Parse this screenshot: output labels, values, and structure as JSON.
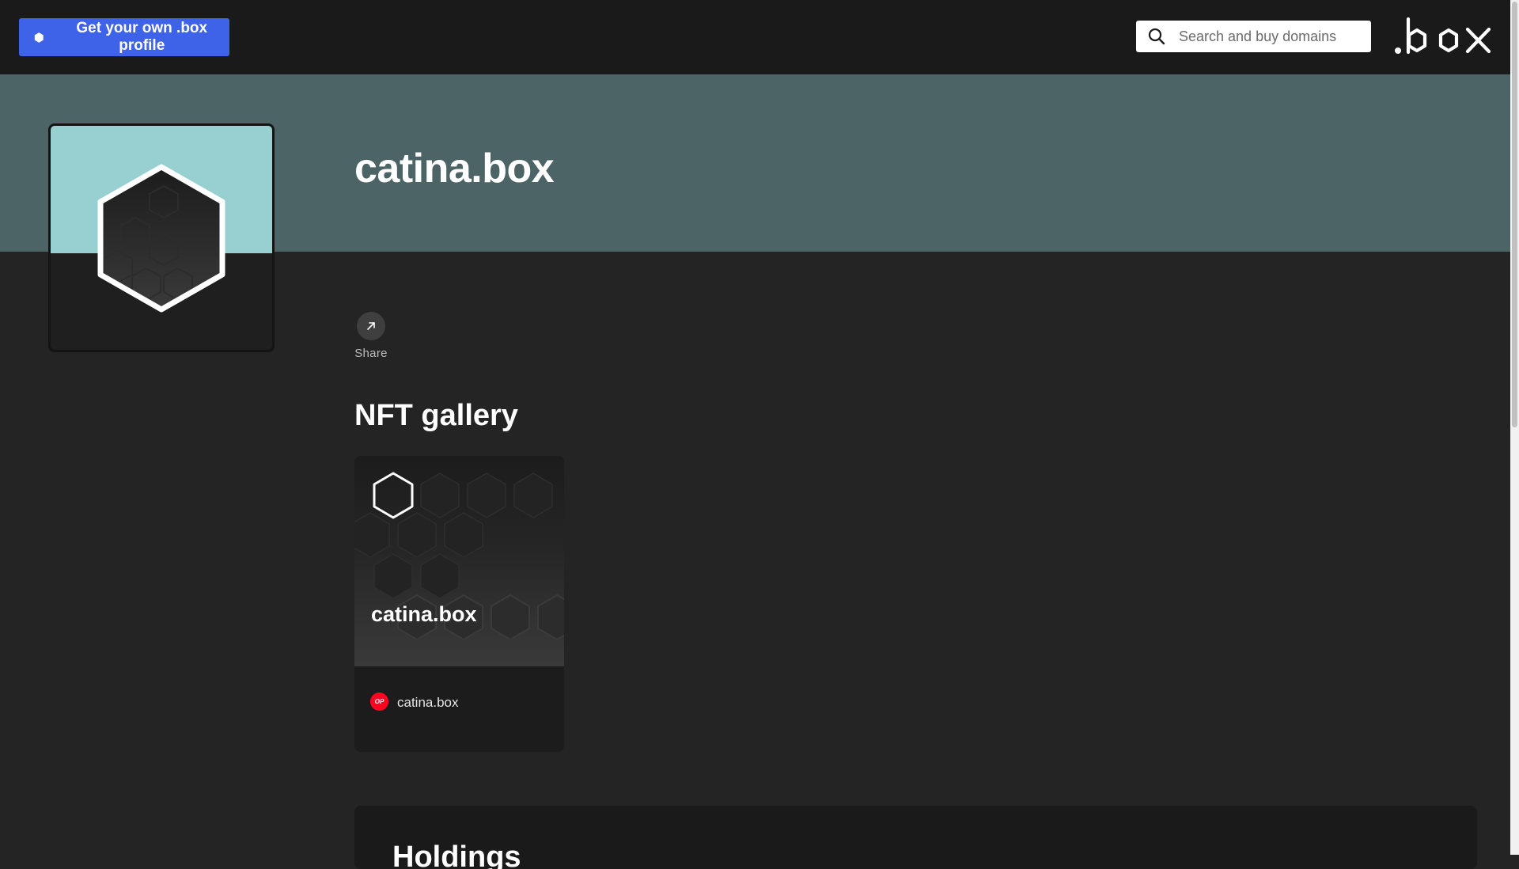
{
  "header": {
    "cta_label": "Get your own .box profile",
    "search_placeholder": "Search and buy domains",
    "logo_icon": "box-logo"
  },
  "profile": {
    "domain": "catina.box",
    "avatar_icon": "hexagon-avatar",
    "share_label": "Share",
    "share_icon": "arrow-up-right-icon"
  },
  "gallery": {
    "title": "NFT gallery",
    "items": [
      {
        "name": "catina.box",
        "chain_badge": "OP",
        "owner_label": "catina.box"
      }
    ]
  },
  "holdings": {
    "title": "Holdings"
  },
  "colors": {
    "topbar": "#1a1a1b",
    "cta": "#3f63e8",
    "banner": "#4d6466",
    "avatar_bg": "#98cfd0",
    "page_bg": "#242424",
    "op_red": "#ff0420"
  }
}
